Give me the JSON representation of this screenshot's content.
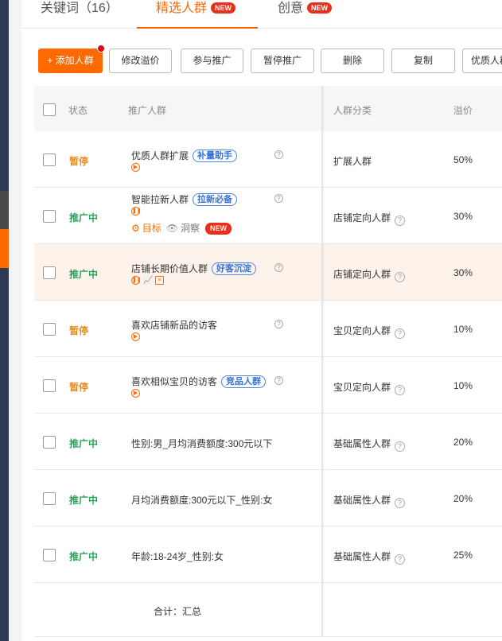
{
  "tabs": [
    {
      "label": "关键词（16）"
    },
    {
      "label": "精选人群",
      "badge": "NEW",
      "active": true
    },
    {
      "label": "创意",
      "badge": "NEW"
    }
  ],
  "toolbar": {
    "add": "+ 添加人群",
    "modify_premium": "修改溢价",
    "join_promo": "参与推广",
    "pause_promo": "暂停推广",
    "delete": "删除",
    "copy": "复制",
    "quality_crowd": "优质人群"
  },
  "table": {
    "headers": {
      "status": "状态",
      "crowd": "推广人群",
      "category": "人群分类",
      "premium": "溢价"
    },
    "rows": [
      {
        "status": "暂停",
        "name": "优质人群扩展",
        "tag": "补量助手",
        "category": "扩展人群",
        "premium": "50%"
      },
      {
        "status": "推广中",
        "name": "智能拉新人群",
        "tag": "拉新必备",
        "goal": "目标",
        "insight": "洞察",
        "badge": "NEW",
        "category": "店铺定向人群",
        "premium": "30%"
      },
      {
        "status": "推广中",
        "name": "店铺长期价值人群",
        "tag": "好客沉淀",
        "category": "店铺定向人群",
        "premium": "30%"
      },
      {
        "status": "暂停",
        "name": "喜欢店铺新品的访客",
        "category": "宝贝定向人群",
        "premium": "10%"
      },
      {
        "status": "暂停",
        "name": "喜欢相似宝贝的访客",
        "tag": "竞品人群",
        "category": "宝贝定向人群",
        "premium": "10%"
      },
      {
        "status": "推广中",
        "name": "性别:男_月均消费额度:300元以下",
        "category": "基础属性人群",
        "premium": "20%"
      },
      {
        "status": "推广中",
        "name": "月均消费额度:300元以下_性别:女",
        "category": "基础属性人群",
        "premium": "20%"
      },
      {
        "status": "推广中",
        "name": "年龄:18-24岁_性别:女",
        "category": "基础属性人群",
        "premium": "25%"
      }
    ],
    "total": "合计：汇总"
  },
  "colors": {
    "accent": "#ff6a00",
    "paused": "#e98a1c",
    "active": "#2aa35a",
    "tag": "#3572d6",
    "new_badge": "#e8301c"
  }
}
